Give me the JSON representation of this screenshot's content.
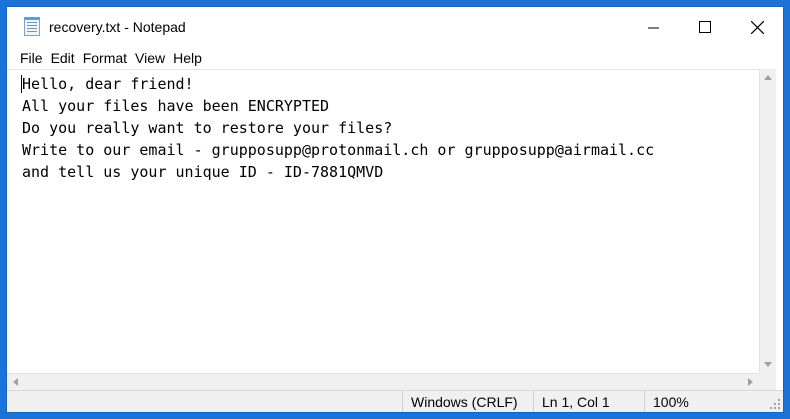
{
  "window": {
    "title": "recovery.txt - Notepad",
    "icons": {
      "app": "notepad-icon",
      "minimize": "minimize-icon",
      "maximize": "maximize-icon",
      "close": "close-icon"
    }
  },
  "menu": {
    "items": [
      "File",
      "Edit",
      "Format",
      "View",
      "Help"
    ]
  },
  "editor": {
    "lines": [
      "Hello, dear friend!",
      "All your files have been ENCRYPTED",
      "Do you really want to restore your files?",
      "Write to our email - grupposupp@protonmail.ch or grupposupp@airmail.cc",
      "and tell us your unique ID - ID-7881QMVD"
    ]
  },
  "status": {
    "encoding": "Windows (CRLF)",
    "position": "Ln 1, Col 1",
    "zoom": "100%"
  },
  "colors": {
    "desktop_border": "#1a73d9",
    "window_background": "#ffffff",
    "chrome_gray": "#f0f0f0"
  }
}
